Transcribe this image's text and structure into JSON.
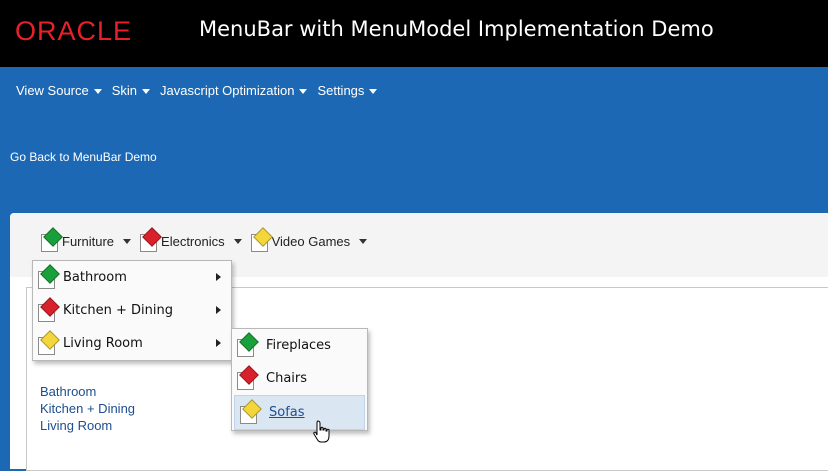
{
  "header": {
    "logo_text": "ORACLE",
    "title": "MenuBar with MenuModel Implementation Demo"
  },
  "top_menu": [
    {
      "label": "View Source"
    },
    {
      "label": "Skin"
    },
    {
      "label": "Javascript Optimization"
    },
    {
      "label": "Settings"
    }
  ],
  "back_link": "Go Back to MenuBar Demo",
  "menubar": [
    {
      "label": "Furniture",
      "icon_color": "#1aa03a"
    },
    {
      "label": "Electronics",
      "icon_color": "#d8212a"
    },
    {
      "label": "Video Games",
      "icon_color": "#f3d63c"
    }
  ],
  "dropdown": [
    {
      "label": "Bathroom",
      "icon_color": "#1aa03a"
    },
    {
      "label": "Kitchen + Dining",
      "icon_color": "#d8212a"
    },
    {
      "label": "Living Room",
      "icon_color": "#f3d63c"
    }
  ],
  "submenu": [
    {
      "label": "Fireplaces",
      "icon_color": "#1aa03a"
    },
    {
      "label": "Chairs",
      "icon_color": "#d8212a"
    },
    {
      "label": "Sofas",
      "icon_color": "#f3d63c",
      "hovered": true
    }
  ],
  "content_links": [
    "Bathroom",
    "Kitchen + Dining",
    "Living Room"
  ],
  "colors": {
    "header_bg": "#000000",
    "band_bg": "#1c68b4",
    "logo_red": "#e8202a",
    "link_blue": "#1d4e91"
  }
}
